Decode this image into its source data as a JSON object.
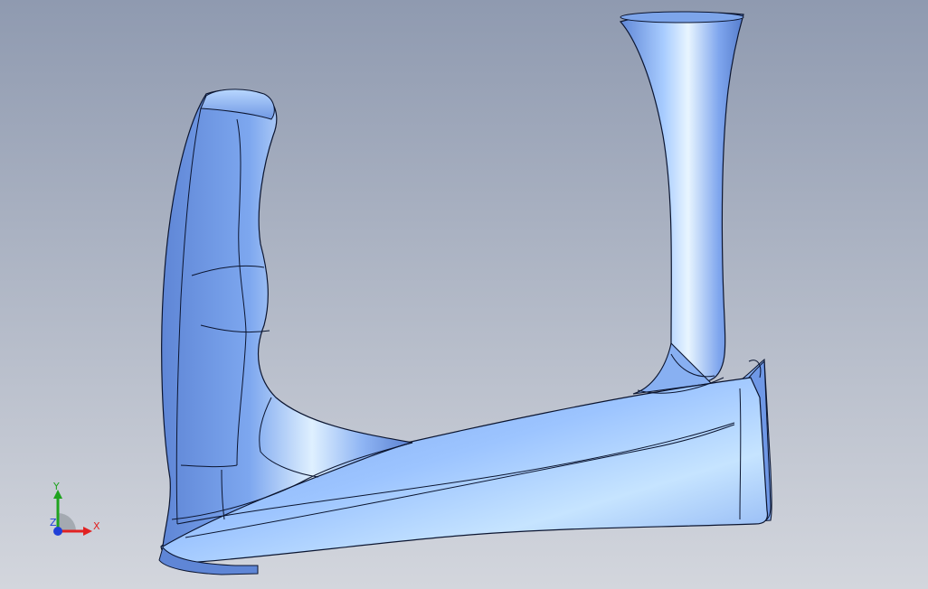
{
  "viewport": {
    "background_top": "#8f9ab0",
    "background_bottom": "#d3d6dd"
  },
  "model": {
    "surface_color": "#7ea6ec",
    "surface_highlight": "#d9ecff",
    "edge_color": "#0b1530"
  },
  "triad": {
    "x_label": "X",
    "y_label": "Y",
    "z_label": "Z",
    "x_color": "#e12222",
    "y_color": "#1fa31f",
    "z_color": "#2040d8"
  }
}
